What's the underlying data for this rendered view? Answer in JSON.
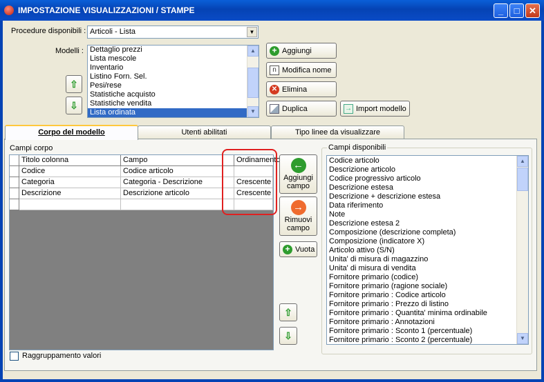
{
  "window": {
    "title": "IMPOSTAZIONE VISUALIZZAZIONI / STAMPE",
    "minimize": "_",
    "maximize": "□",
    "close": "✕"
  },
  "procedure": {
    "label": "Procedure disponibili :",
    "value": "Articoli - Lista"
  },
  "modelli": {
    "label": "Modelli :",
    "items": [
      "Dettaglio prezzi",
      "Lista mescole",
      "Inventario",
      "Listino Forn. Sel.",
      "Pesi/rese",
      "Statistiche acquisto",
      "Statistiche vendita",
      "Lista ordinata"
    ],
    "selected": "Lista ordinata"
  },
  "buttons": {
    "aggiungi": "Aggiungi",
    "modifica": "Modifica nome",
    "elimina": "Elimina",
    "duplica": "Duplica",
    "import": "Import modello",
    "up": "⇧",
    "down": "⇩"
  },
  "tabs": [
    "Corpo del modello",
    "Utenti abilitati",
    "Tipo linee da visualizzare"
  ],
  "campi_corpo": {
    "label": "Campi corpo",
    "columns": [
      "Titolo colonna",
      "Campo",
      "Ordinamento"
    ],
    "rows": [
      [
        "Codice",
        "Codice articolo",
        ""
      ],
      [
        "Categoria",
        "Categoria - Descrizione",
        "Crescente"
      ],
      [
        "Descrizione",
        "Descrizione articolo",
        "Crescente"
      ]
    ]
  },
  "middle": {
    "aggiungi_l1": "Aggiungi",
    "aggiungi_l2": "campo",
    "rimuovi_l1": "Rimuovi",
    "rimuovi_l2": "campo",
    "vuota": "Vuota"
  },
  "campi_disponibili": {
    "label": "Campi disponibili",
    "items": [
      "Codice articolo",
      "Descrizione articolo",
      "Codice progressivo articolo",
      "Descrizione estesa",
      "Descrizione + descrizione estesa",
      "Data riferimento",
      "Note",
      "Descrizione estesa 2",
      "Composizione (descrizione completa)",
      "Composizione (indicatore X)",
      "Articolo attivo (S/N)",
      "Unita' di misura di magazzino",
      "Unita' di misura di vendita",
      "Fornitore primario (codice)",
      "Fornitore primario (ragione sociale)",
      "Fornitore primario : Codice articolo",
      "Fornitore primario : Prezzo di listino",
      "Fornitore primario : Quantita' minima ordinabile",
      "Fornitore primario : Annotazioni",
      "Fornitore primario : Sconto 1 (percentuale)",
      "Fornitore primario : Sconto 2 (percentuale)"
    ]
  },
  "raggruppamento": {
    "label": "Raggruppamento valori"
  }
}
